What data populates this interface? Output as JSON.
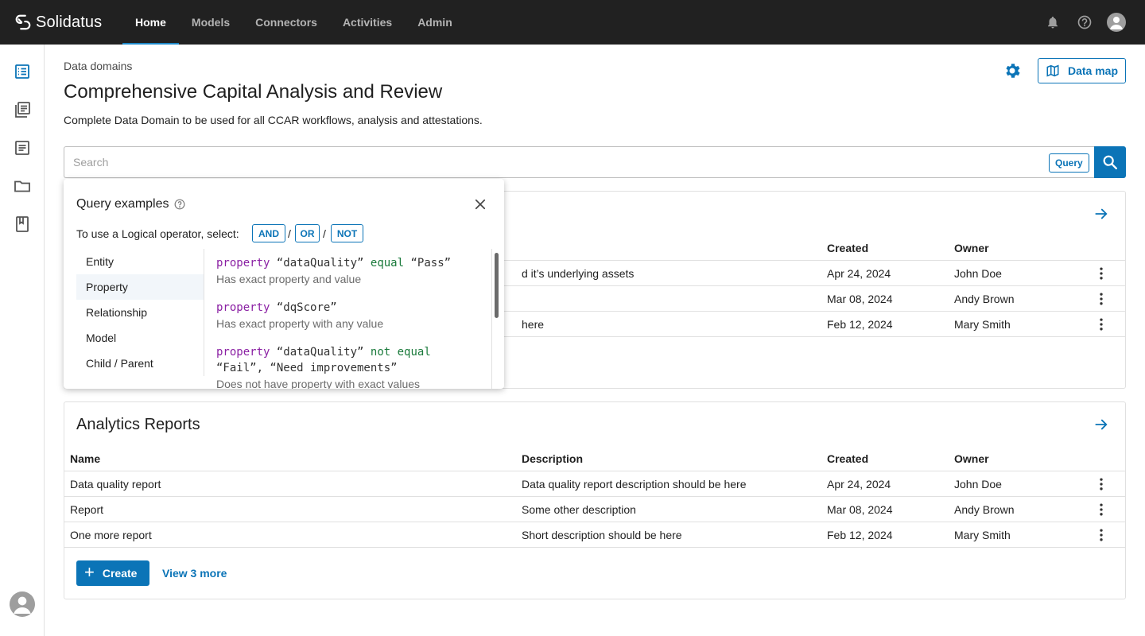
{
  "app": {
    "brand": "Solidatus",
    "nav": [
      "Home",
      "Models",
      "Connectors",
      "Activities",
      "Admin"
    ],
    "active_nav": "Home"
  },
  "header": {
    "breadcrumb": "Data domains",
    "title": "Comprehensive Capital Analysis and Review",
    "description": "Complete Data Domain to be used for all CCAR workflows, analysis and attestations.",
    "data_map_label": "Data map"
  },
  "search": {
    "placeholder": "Search",
    "query_label": "Query"
  },
  "top_card": {
    "columns": {
      "created": "Created",
      "owner": "Owner"
    },
    "rows": [
      {
        "desc_tail": "d it’s underlying assets",
        "created": "Apr 24, 2024",
        "owner": "John Doe"
      },
      {
        "desc_tail": "",
        "created": "Mar 08, 2024",
        "owner": "Andy Brown"
      },
      {
        "desc_tail": "here",
        "created": "Feb 12, 2024",
        "owner": "Mary Smith"
      }
    ]
  },
  "analytics": {
    "title": "Analytics Reports",
    "columns": {
      "name": "Name",
      "description": "Description",
      "created": "Created",
      "owner": "Owner"
    },
    "rows": [
      {
        "name": "Data quality report",
        "description": "Data quality report description should be here",
        "created": "Apr 24, 2024",
        "owner": "John Doe"
      },
      {
        "name": "Report",
        "description": "Some other description",
        "created": "Mar 08, 2024",
        "owner": "Andy Brown"
      },
      {
        "name": "One more report",
        "description": "Short description should be here",
        "created": "Feb 12, 2024",
        "owner": "Mary Smith"
      }
    ],
    "create_label": "Create",
    "view_more_label": "View 3 more"
  },
  "popover": {
    "title": "Query examples",
    "instruction": "To use a Logical operator, select:",
    "operators": [
      "AND",
      "OR",
      "NOT"
    ],
    "separator": "/",
    "categories": [
      "Entity",
      "Property",
      "Relationship",
      "Model",
      "Child / Parent"
    ],
    "active_category": "Property",
    "examples": [
      {
        "kw": "property",
        "field": "“dataQuality”",
        "op": "equal",
        "value": "“Pass”",
        "value2": "",
        "desc": "Has exact property and value"
      },
      {
        "kw": "property",
        "field": "“dqScore”",
        "op": "",
        "value": "",
        "value2": "",
        "desc": "Has exact property with any value"
      },
      {
        "kw": "property",
        "field": "“dataQuality”",
        "op": "not equal",
        "value": "",
        "value2": "“Fail”, “Need improvements”",
        "desc": "Does not have property with exact values"
      }
    ]
  },
  "colors": {
    "primary": "#0b74b7",
    "topbar": "#212121",
    "keyword": "#8a1fa3",
    "operator": "#1a7a3b"
  },
  "icons": {
    "topbar": [
      "bell-icon",
      "help-icon",
      "account-icon"
    ],
    "rail": [
      "list-icon",
      "library-icon",
      "document-icon",
      "folder-icon",
      "book-icon"
    ]
  }
}
